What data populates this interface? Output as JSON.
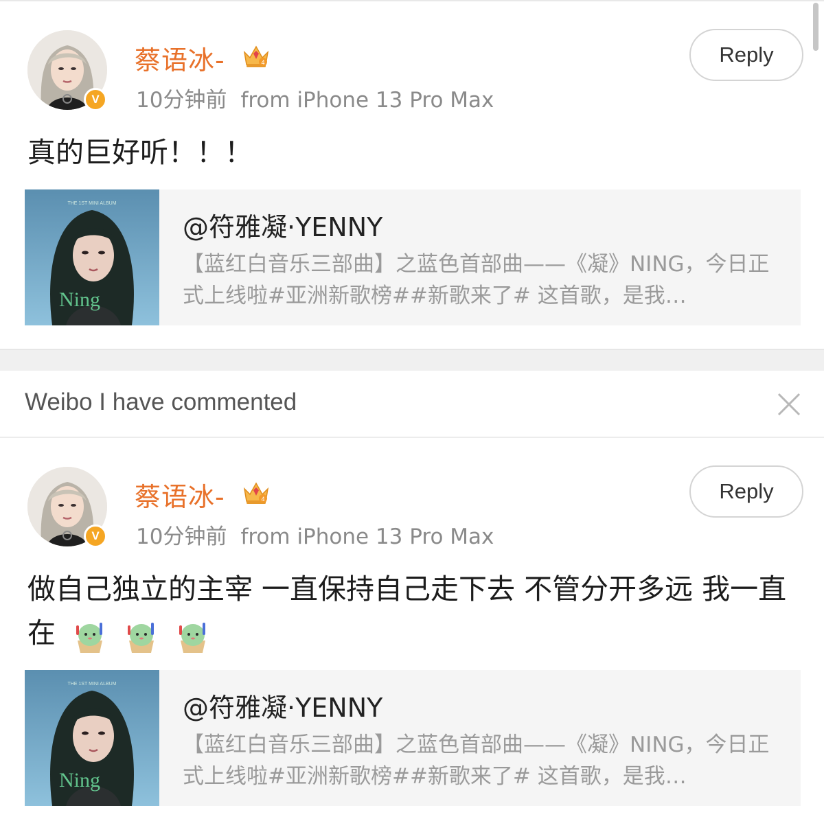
{
  "comments": [
    {
      "author": "蔡语冰-",
      "time": "10分钟前",
      "source": "from iPhone 13 Pro Max",
      "reply_label": "Reply",
      "text": "真的巨好听！！！",
      "quoted": {
        "author": "@符雅凝·YENNY",
        "text": "【蓝红白音乐三部曲】之蓝色首部曲——《凝》NING，今日正式上线啦#亚洲新歌榜##新歌来了# 这首歌，是我…"
      }
    },
    {
      "author": "蔡语冰-",
      "time": "10分钟前",
      "source": "from iPhone 13 Pro Max",
      "reply_label": "Reply",
      "text": "做自己独立的主宰 一直保持自己走下去 不管分开多远 我一直在",
      "quoted": {
        "author": "@符雅凝·YENNY",
        "text": "【蓝红白音乐三部曲】之蓝色首部曲——《凝》NING，今日正式上线啦#亚洲新歌榜##新歌来了# 这首歌，是我…"
      }
    }
  ],
  "section": {
    "title": "Weibo I have commented"
  },
  "verified_badge": "V",
  "icons": {
    "crown": "crown-level-icon",
    "close": "close-icon",
    "emoji": "cactus-emoji-icon"
  },
  "colors": {
    "author_name": "#e8712a",
    "verified": "#f5a623",
    "meta": "#8a8a8a"
  }
}
